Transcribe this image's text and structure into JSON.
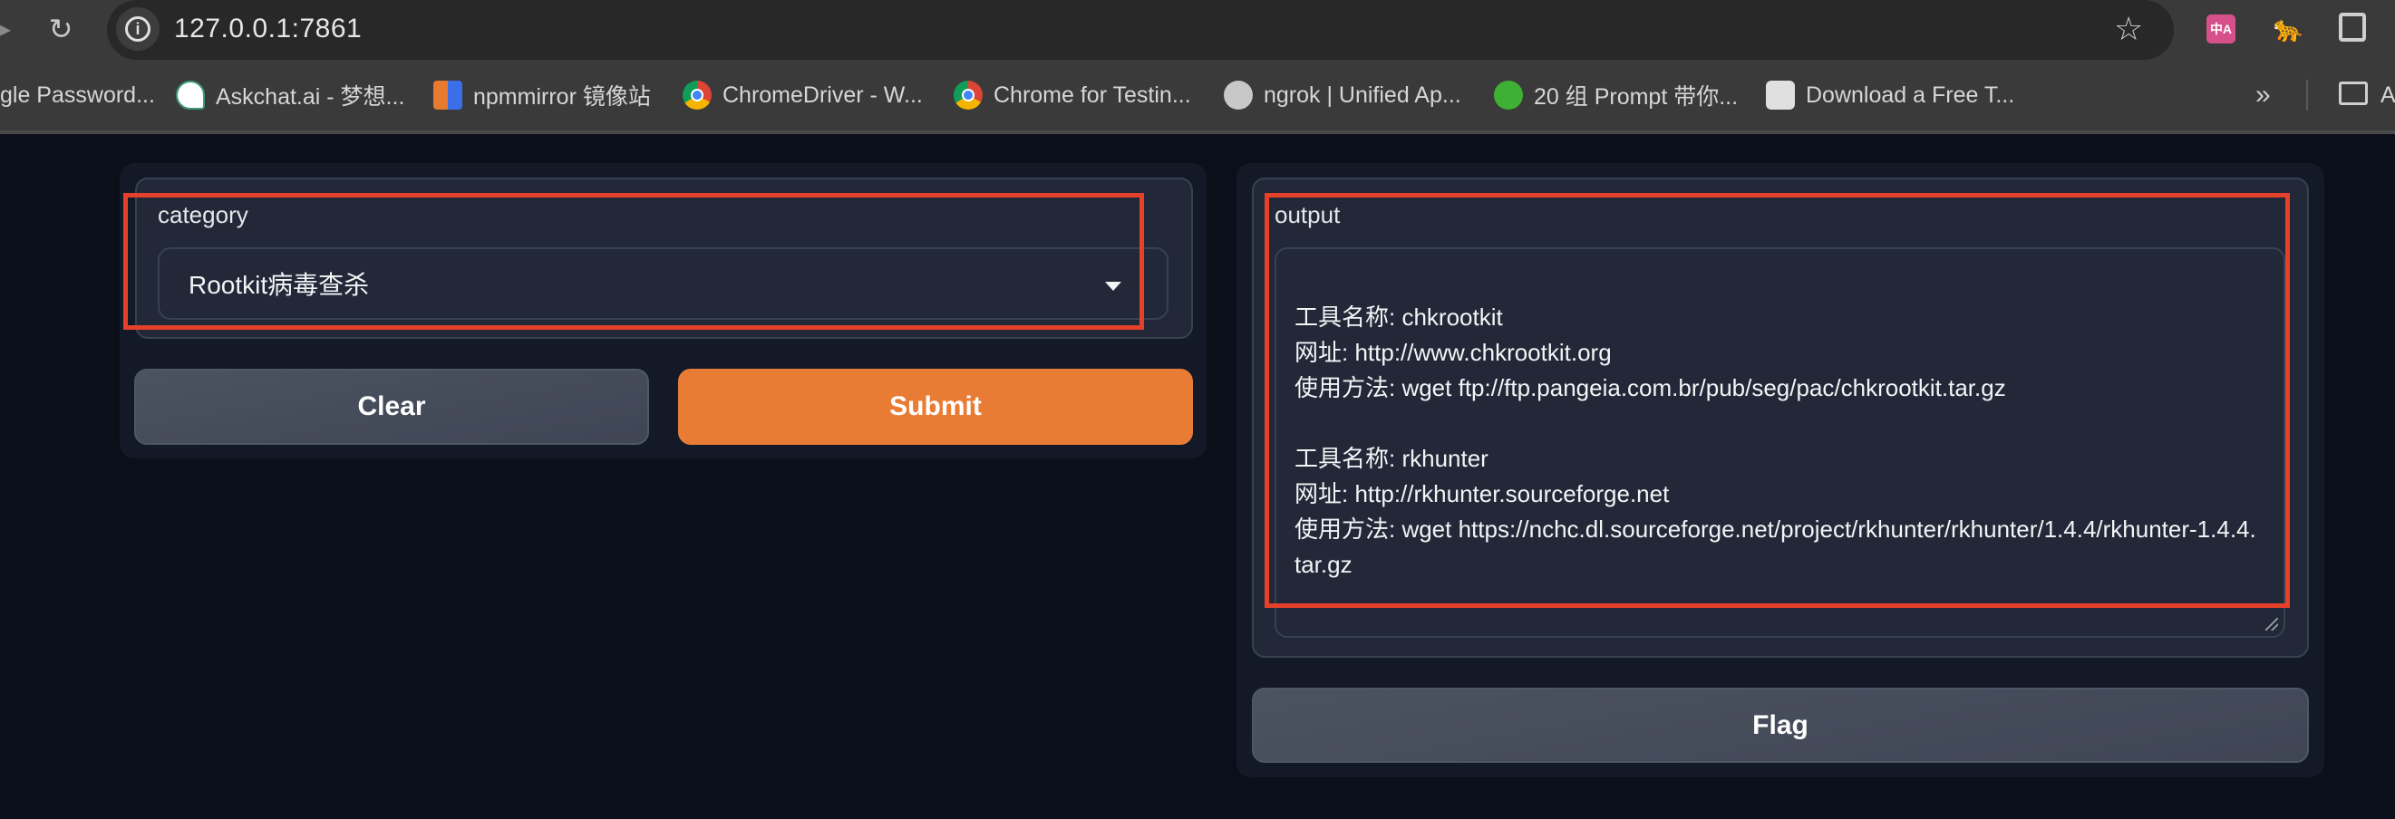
{
  "browser": {
    "url": "127.0.0.1:7861",
    "bookmarks": [
      {
        "label": "gle Password...",
        "icon": "none"
      },
      {
        "label": "Askchat.ai - 梦想...",
        "icon": "askchat-icon"
      },
      {
        "label": "npmmirror 镜像站",
        "icon": "npmmirror-icon"
      },
      {
        "label": "ChromeDriver - W...",
        "icon": "chrome-icon"
      },
      {
        "label": "Chrome for Testin...",
        "icon": "chrome-testing-icon"
      },
      {
        "label": "ngrok | Unified Ap...",
        "icon": "globe-icon"
      },
      {
        "label": "20 组 Prompt 带你...",
        "icon": "wechat-icon"
      },
      {
        "label": "Download a Free T...",
        "icon": "download-icon"
      }
    ],
    "bookmarks_more": "»",
    "bookmarks_folder_label": "A",
    "extensions": {
      "translate_glyph": "中A",
      "cat_glyph": "🐆"
    }
  },
  "app": {
    "input": {
      "label": "category",
      "selected": "Rootkit病毒查杀"
    },
    "buttons": {
      "clear": "Clear",
      "submit": "Submit",
      "flag": "Flag"
    },
    "output": {
      "label": "output",
      "value": "工具名称: chkrootkit\n网址: http://www.chkrootkit.org\n使用方法: wget ftp://ftp.pangeia.com.br/pub/seg/pac/chkrootkit.tar.gz\n\n工具名称: rkhunter\n网址: http://rkhunter.sourceforge.net\n使用方法: wget https://nchc.dl.sourceforge.net/project/rkhunter/rkhunter/1.4.4/rkhunter-1.4.4.tar.gz"
    }
  },
  "colors": {
    "primary": "#e97c35",
    "annotation": "#e5402a",
    "background": "#0b0f19"
  }
}
